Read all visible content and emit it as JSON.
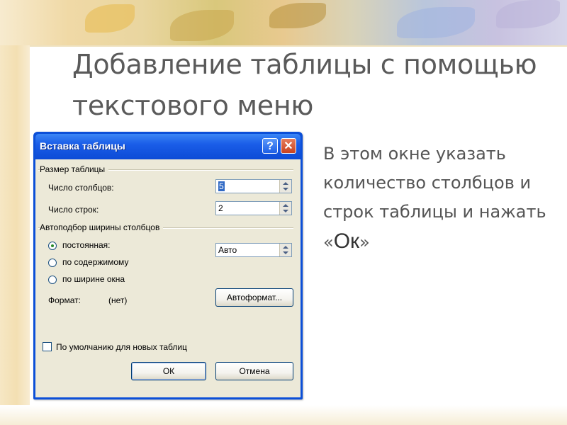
{
  "slide": {
    "title": "Добавление таблицы с помощью текстового меню",
    "body_before": "В этом окне указать количество столбцов и строк таблицы и нажать «",
    "body_ok": "Ок",
    "body_after": "»"
  },
  "dialog": {
    "title": "Вставка таблицы",
    "help_glyph": "?",
    "close_glyph": "✕",
    "group_size": "Размер таблицы",
    "columns_label": "Число столбцов:",
    "columns_value": "5",
    "rows_label": "Число строк:",
    "rows_value": "2",
    "group_autofit": "Автоподбор ширины столбцов",
    "radio_fixed": "постоянная:",
    "fixed_value": "Авто",
    "radio_contents": "по содержимому",
    "radio_window": "по ширине окна",
    "format_label": "Формат:",
    "format_value": "(нет)",
    "autoformat_button": "Автоформат...",
    "default_checkbox": "По умолчанию для новых таблиц",
    "ok_button": "ОК",
    "cancel_button": "Отмена"
  },
  "colors": {
    "titlebar": "#0b4fd8",
    "dialog_body": "#ece9d8",
    "slide_text": "#5a5a5a"
  }
}
